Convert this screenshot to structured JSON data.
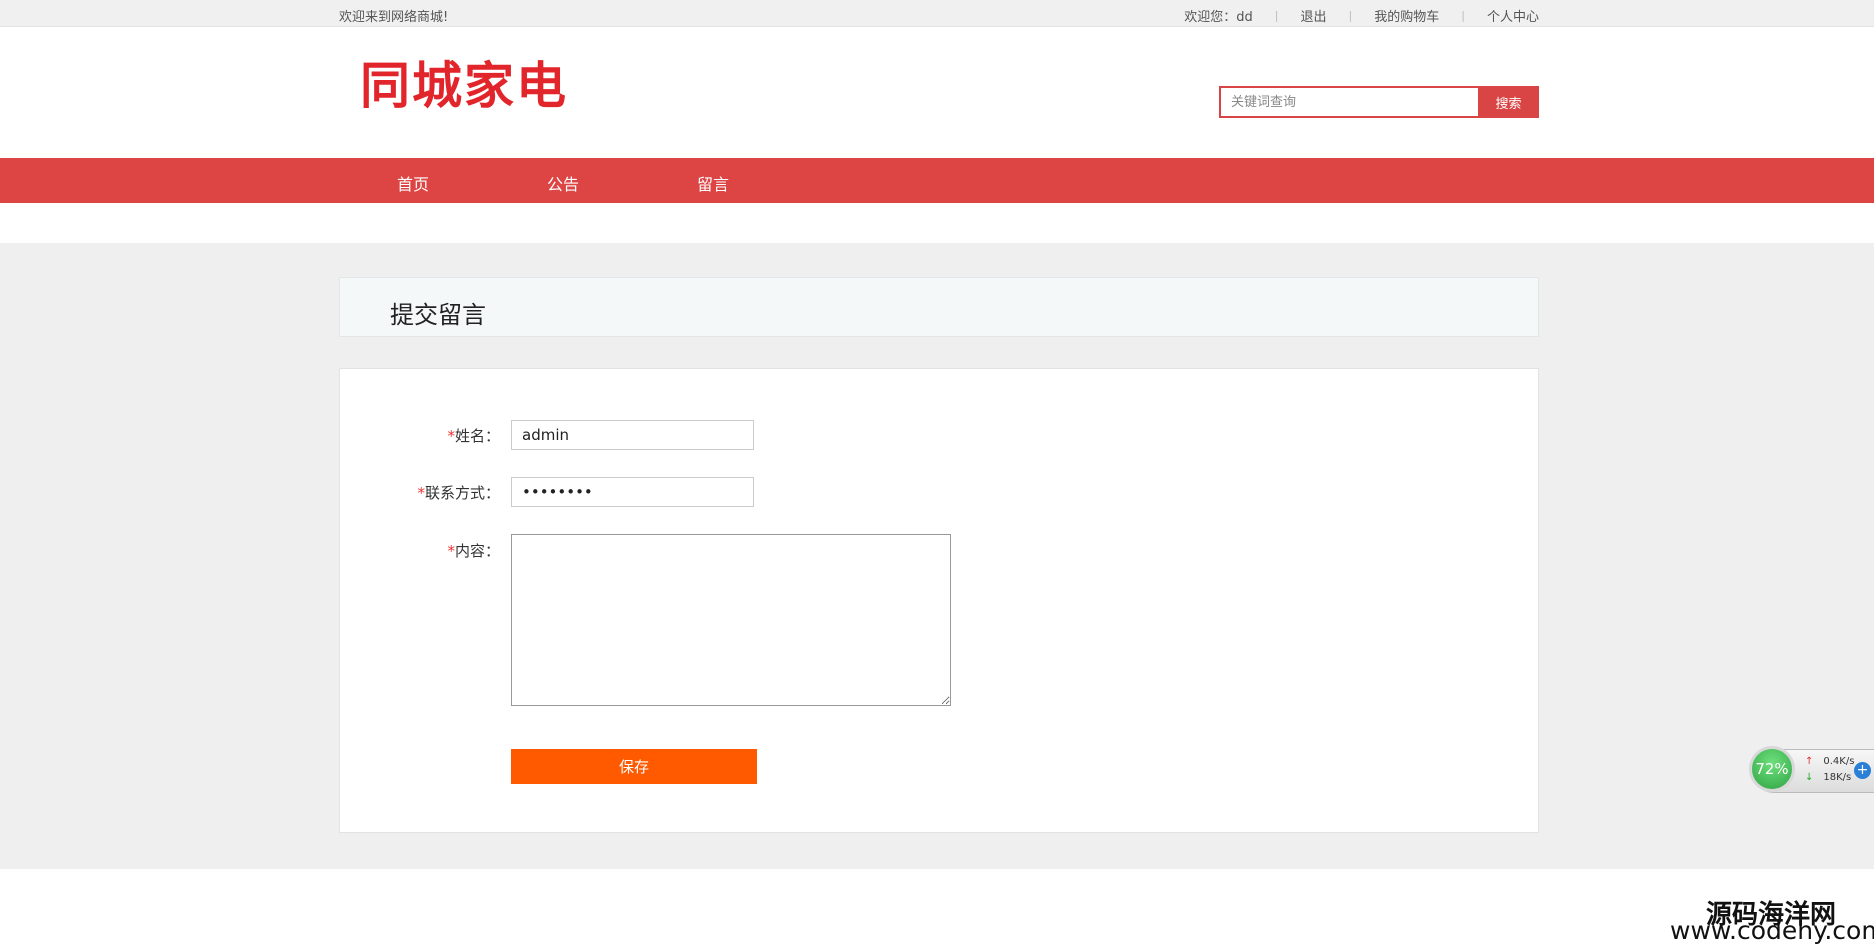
{
  "topbar": {
    "welcome": "欢迎来到网络商城!",
    "greeting": "欢迎您：dd",
    "logout": "退出",
    "cart": "我的购物车",
    "profile": "个人中心",
    "separator": "|"
  },
  "header": {
    "logo_text": "同城家电",
    "search_placeholder": "关键词查询",
    "search_button": "搜索"
  },
  "nav": {
    "items": [
      {
        "label": "首页"
      },
      {
        "label": "公告"
      },
      {
        "label": "留言"
      }
    ]
  },
  "page": {
    "title": "提交留言"
  },
  "form": {
    "required_mark": "*",
    "name_label": "姓名：",
    "name_value": "admin",
    "contact_label": "联系方式：",
    "contact_value": "••••••••",
    "content_label": "内容：",
    "content_value": "",
    "save_button": "保存"
  },
  "widget": {
    "percent": "72%",
    "upload": "0.4K/s",
    "download": "18K/s",
    "up_arrow": "↑",
    "down_arrow": "↓",
    "plus": "+"
  },
  "watermark": {
    "line1": "源码海洋网",
    "line2": "www.codehy.com"
  },
  "colors": {
    "brand_red": "#dd4444",
    "logo_red": "#e1252b",
    "save_orange": "#ff5a00"
  }
}
